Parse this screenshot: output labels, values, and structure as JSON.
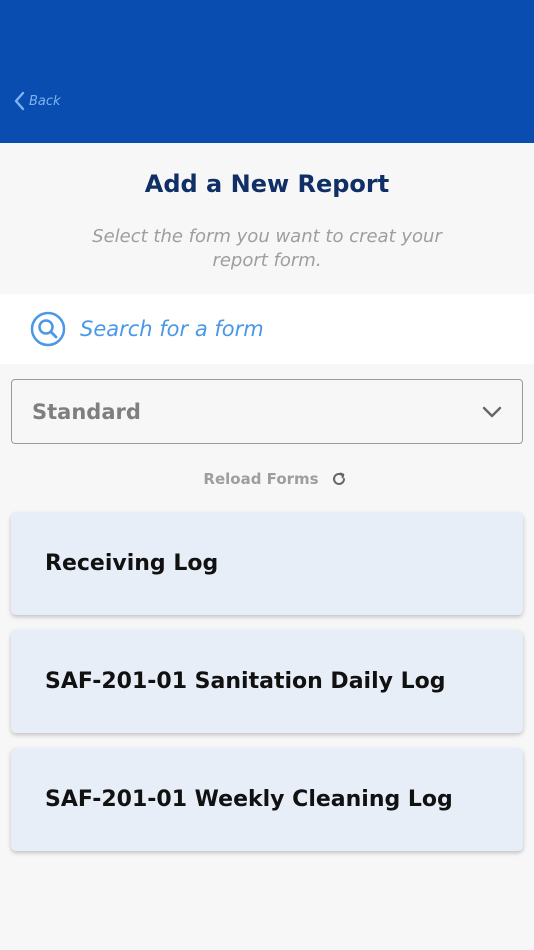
{
  "header": {
    "back_label": "Back",
    "color": "#0a4db1"
  },
  "page": {
    "title": "Add a New Report",
    "subtitle": "Select the form you want to creat your report form."
  },
  "search": {
    "placeholder": "Search for a form",
    "value": "",
    "icon": "search-icon"
  },
  "filter": {
    "selected": "Standard",
    "icon": "chevron-down-icon"
  },
  "reload": {
    "label": "Reload Forms",
    "icon": "refresh-icon"
  },
  "forms": [
    {
      "label": "Receiving Log"
    },
    {
      "label": "SAF-201-01 Sanitation Daily Log"
    },
    {
      "label": "SAF-201-01 Weekly Cleaning Log"
    }
  ],
  "colors": {
    "accent": "#4a98e6",
    "title": "#0f2f66",
    "card_bg": "#e8eef7"
  }
}
